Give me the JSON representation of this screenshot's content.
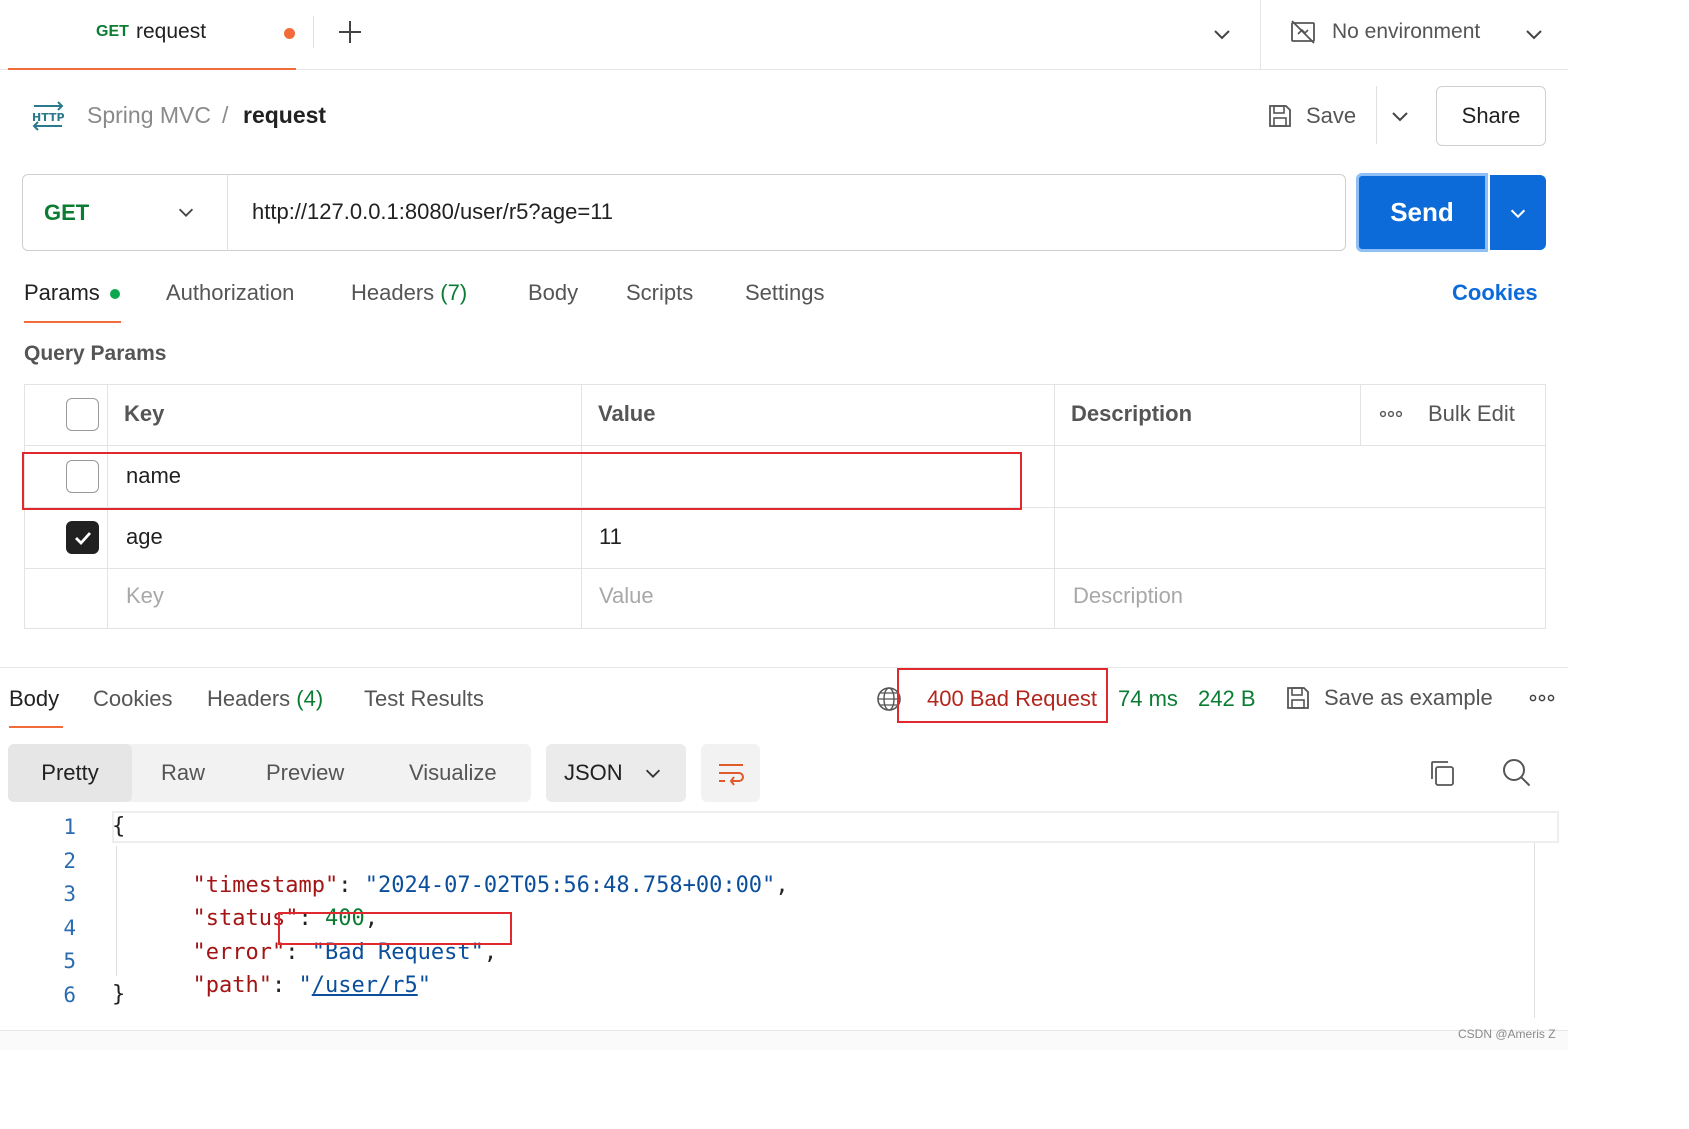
{
  "tab": {
    "method": "GET",
    "title": "request",
    "unsaved": true
  },
  "environment": {
    "label": "No environment"
  },
  "breadcrumb": {
    "icon": "http-icon",
    "parent": "Spring MVC",
    "separator": "/",
    "current": "request"
  },
  "actions": {
    "save_label": "Save",
    "share_label": "Share"
  },
  "request": {
    "method": "GET",
    "url": "http://127.0.0.1:8080/user/r5?age=11",
    "send_label": "Send"
  },
  "request_tabs": {
    "params": "Params",
    "authorization": "Authorization",
    "headers": "Headers",
    "headers_count": "(7)",
    "body": "Body",
    "scripts": "Scripts",
    "settings": "Settings",
    "cookies": "Cookies"
  },
  "query_params": {
    "title": "Query Params",
    "headers": {
      "key": "Key",
      "value": "Value",
      "description": "Description",
      "bulk_edit": "Bulk Edit"
    },
    "rows": [
      {
        "checked": false,
        "key": "name",
        "value": "",
        "description": ""
      },
      {
        "checked": true,
        "key": "age",
        "value": "11",
        "description": ""
      }
    ],
    "placeholders": {
      "key": "Key",
      "value": "Value",
      "description": "Description"
    }
  },
  "response_tabs": {
    "body": "Body",
    "cookies": "Cookies",
    "headers": "Headers",
    "headers_count": "(4)",
    "test_results": "Test Results"
  },
  "response_meta": {
    "status": "400 Bad Request",
    "time": "74 ms",
    "size": "242 B",
    "save_example": "Save as example"
  },
  "format": {
    "modes": {
      "pretty": "Pretty",
      "raw": "Raw",
      "preview": "Preview",
      "visualize": "Visualize"
    },
    "language": "JSON"
  },
  "code": {
    "line_numbers": [
      "1",
      "2",
      "3",
      "4",
      "5",
      "6"
    ],
    "open": "{",
    "close": "}",
    "timestamp_key": "\"timestamp\"",
    "timestamp_val": "\"2024-07-02T05:56:48.758+00:00\"",
    "status_key": "\"status\"",
    "status_val": "400",
    "error_key": "\"error\"",
    "error_val": "\"Bad Request\"",
    "path_key": "\"path\"",
    "path_val_open": "\"",
    "path_val_link": "/user/r5",
    "path_val_close": "\"",
    "colon": ": ",
    "comma": ","
  },
  "watermark": "CSDN @Ameris Z",
  "colors": {
    "accent": "#f26b3a",
    "send": "#0d6bd9",
    "get": "#0b7d33",
    "error": "#e0292f"
  }
}
